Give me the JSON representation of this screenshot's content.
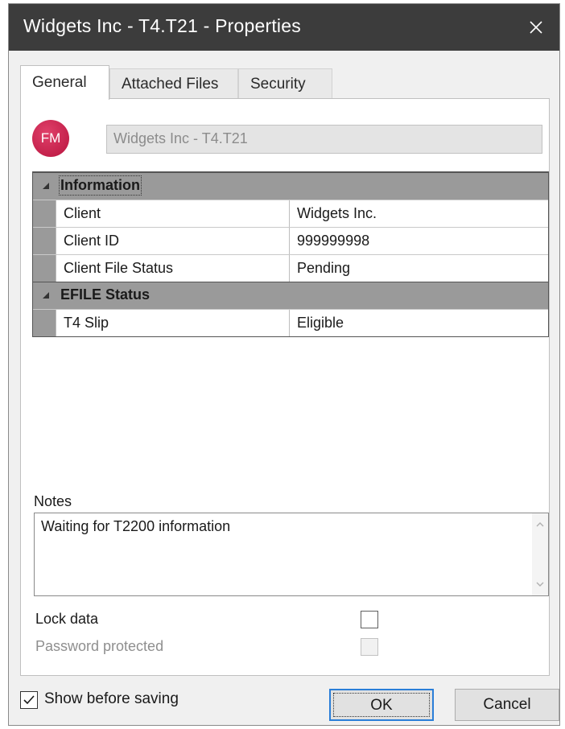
{
  "window": {
    "title": "Widgets Inc - T4.T21 - Properties",
    "close_label": "close"
  },
  "tabs": [
    {
      "label": "General",
      "active": true
    },
    {
      "label": "Attached Files",
      "active": false
    },
    {
      "label": "Security",
      "active": false
    }
  ],
  "general": {
    "avatar_initials": "FM",
    "avatar_color": "#c91f4b",
    "file_name": "Widgets Inc - T4.T21",
    "categories": [
      {
        "name": "Information",
        "expanded": true,
        "rows": [
          {
            "name": "Client",
            "value": "Widgets Inc."
          },
          {
            "name": "Client ID",
            "value": "999999998"
          },
          {
            "name": "Client File Status",
            "value": "Pending"
          }
        ]
      },
      {
        "name": "EFILE Status",
        "expanded": true,
        "rows": [
          {
            "name": "T4 Slip",
            "value": "Eligible"
          }
        ]
      }
    ],
    "notes_label": "Notes",
    "notes_text": "Waiting for T2200 information",
    "lock_data_label": "Lock data",
    "lock_data_checked": false,
    "password_protected_label": "Password protected",
    "password_protected_checked": false,
    "password_protected_enabled": false
  },
  "footer": {
    "show_before_saving_label": "Show before saving",
    "show_before_saving_checked": true,
    "ok_label": "OK",
    "cancel_label": "Cancel"
  },
  "colors": {
    "titlebar": "#3c3c3c",
    "category_header": "#9a9a9a",
    "focus_blue": "#2a7ed8"
  }
}
